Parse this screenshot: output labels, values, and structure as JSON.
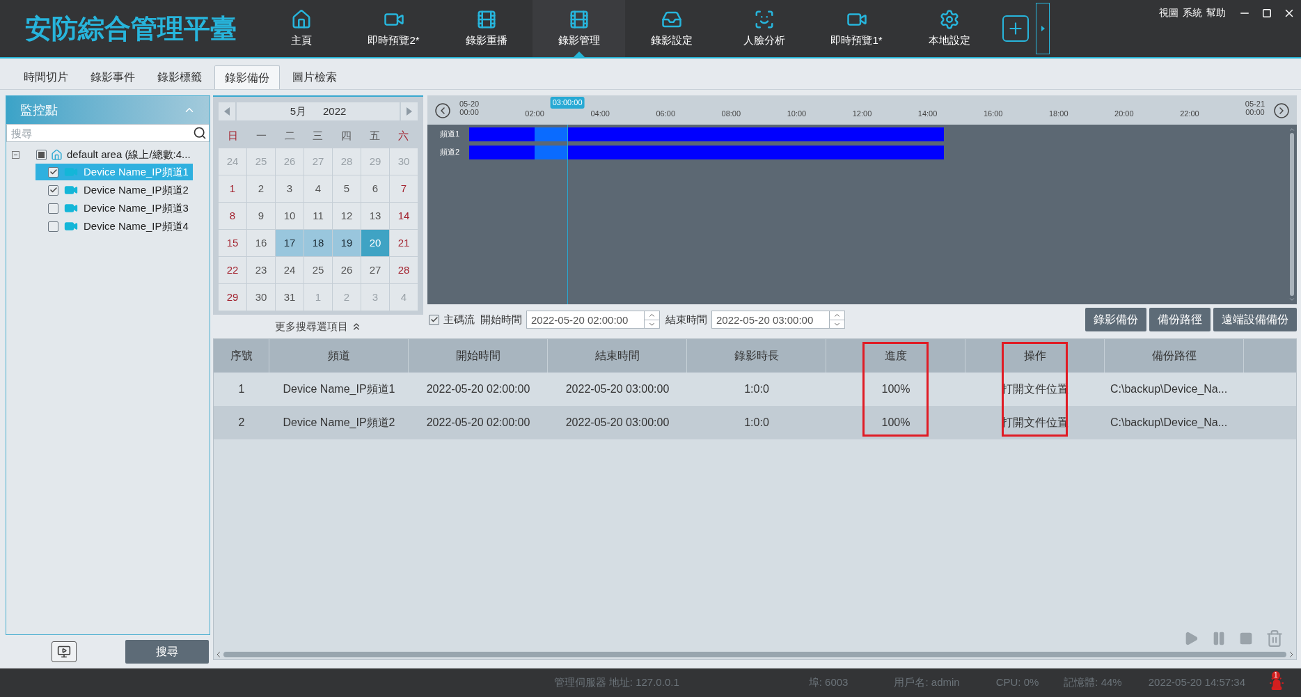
{
  "app": {
    "title": "安防綜合管理平臺"
  },
  "nav": [
    {
      "label": "主頁",
      "kind": "home",
      "selected": false
    },
    {
      "label": "即時預覽2*",
      "kind": "camera",
      "selected": false
    },
    {
      "label": "錄影重播",
      "kind": "reel",
      "selected": false
    },
    {
      "label": "錄影管理",
      "kind": "reel",
      "selected": true
    },
    {
      "label": "錄影設定",
      "kind": "tray",
      "selected": false
    },
    {
      "label": "人臉分析",
      "kind": "face",
      "selected": false
    },
    {
      "label": "即時預覽1*",
      "kind": "camera",
      "selected": false
    },
    {
      "label": "本地設定",
      "kind": "gear",
      "selected": false
    }
  ],
  "menu": [
    "視圖",
    "系統",
    "幫助"
  ],
  "tabs": [
    {
      "label": "時間切片",
      "selected": false
    },
    {
      "label": "錄影事件",
      "selected": false
    },
    {
      "label": "錄影標籤",
      "selected": false
    },
    {
      "label": "錄影備份",
      "selected": true
    },
    {
      "label": "圖片檢索",
      "selected": false
    }
  ],
  "sidebar": {
    "title": "監控點",
    "search": {
      "placeholder": "搜尋"
    },
    "tree": {
      "label": "default area (線上/總數:4...",
      "checked": true,
      "partial": true,
      "expanded": true,
      "children": [
        {
          "label": "Device Name_IP頻道1",
          "checked": true,
          "selected": true
        },
        {
          "label": "Device Name_IP頻道2",
          "checked": true,
          "selected": false
        },
        {
          "label": "Device Name_IP頻道3",
          "checked": false,
          "selected": false
        },
        {
          "label": "Device Name_IP頻道4",
          "checked": false,
          "selected": false
        }
      ]
    },
    "search_button": "搜尋"
  },
  "calendar": {
    "month": "5月",
    "year": "2022",
    "weekdays": [
      "日",
      "一",
      "二",
      "三",
      "四",
      "五",
      "六"
    ],
    "weeks": [
      [
        {
          "day": "24",
          "in_month": false,
          "has_record": false,
          "selected": false
        },
        {
          "day": "25",
          "in_month": false,
          "has_record": false,
          "selected": false
        },
        {
          "day": "26",
          "in_month": false,
          "has_record": false,
          "selected": false
        },
        {
          "day": "27",
          "in_month": false,
          "has_record": false,
          "selected": false
        },
        {
          "day": "28",
          "in_month": false,
          "has_record": false,
          "selected": false
        },
        {
          "day": "29",
          "in_month": false,
          "has_record": false,
          "selected": false
        },
        {
          "day": "30",
          "in_month": false,
          "has_record": false,
          "selected": false
        }
      ],
      [
        {
          "day": "1",
          "in_month": true,
          "has_record": false,
          "selected": false
        },
        {
          "day": "2",
          "in_month": true,
          "has_record": false,
          "selected": false
        },
        {
          "day": "3",
          "in_month": true,
          "has_record": false,
          "selected": false
        },
        {
          "day": "4",
          "in_month": true,
          "has_record": false,
          "selected": false
        },
        {
          "day": "5",
          "in_month": true,
          "has_record": false,
          "selected": false
        },
        {
          "day": "6",
          "in_month": true,
          "has_record": false,
          "selected": false
        },
        {
          "day": "7",
          "in_month": true,
          "has_record": false,
          "selected": false
        }
      ],
      [
        {
          "day": "8",
          "in_month": true,
          "has_record": false,
          "selected": false
        },
        {
          "day": "9",
          "in_month": true,
          "has_record": false,
          "selected": false
        },
        {
          "day": "10",
          "in_month": true,
          "has_record": false,
          "selected": false
        },
        {
          "day": "11",
          "in_month": true,
          "has_record": false,
          "selected": false
        },
        {
          "day": "12",
          "in_month": true,
          "has_record": false,
          "selected": false
        },
        {
          "day": "13",
          "in_month": true,
          "has_record": false,
          "selected": false
        },
        {
          "day": "14",
          "in_month": true,
          "has_record": false,
          "selected": false
        }
      ],
      [
        {
          "day": "15",
          "in_month": true,
          "has_record": false,
          "selected": false
        },
        {
          "day": "16",
          "in_month": true,
          "has_record": false,
          "selected": false
        },
        {
          "day": "17",
          "in_month": true,
          "has_record": true,
          "selected": false
        },
        {
          "day": "18",
          "in_month": true,
          "has_record": true,
          "selected": false
        },
        {
          "day": "19",
          "in_month": true,
          "has_record": true,
          "selected": false
        },
        {
          "day": "20",
          "in_month": true,
          "has_record": true,
          "selected": true
        },
        {
          "day": "21",
          "in_month": true,
          "has_record": false,
          "selected": false
        }
      ],
      [
        {
          "day": "22",
          "in_month": true,
          "has_record": false,
          "selected": false
        },
        {
          "day": "23",
          "in_month": true,
          "has_record": false,
          "selected": false
        },
        {
          "day": "24",
          "in_month": true,
          "has_record": false,
          "selected": false
        },
        {
          "day": "25",
          "in_month": true,
          "has_record": false,
          "selected": false
        },
        {
          "day": "26",
          "in_month": true,
          "has_record": false,
          "selected": false
        },
        {
          "day": "27",
          "in_month": true,
          "has_record": false,
          "selected": false
        },
        {
          "day": "28",
          "in_month": true,
          "has_record": false,
          "selected": false
        }
      ],
      [
        {
          "day": "29",
          "in_month": true,
          "has_record": false,
          "selected": false
        },
        {
          "day": "30",
          "in_month": true,
          "has_record": false,
          "selected": false
        },
        {
          "day": "31",
          "in_month": true,
          "has_record": false,
          "selected": false
        },
        {
          "day": "1",
          "in_month": false,
          "has_record": false,
          "selected": false
        },
        {
          "day": "2",
          "in_month": false,
          "has_record": false,
          "selected": false
        },
        {
          "day": "3",
          "in_month": false,
          "has_record": false,
          "selected": false
        },
        {
          "day": "4",
          "in_month": false,
          "has_record": false,
          "selected": false
        }
      ]
    ],
    "more_options": "更多搜尋選項目"
  },
  "timeline": {
    "start_date": "05-20",
    "start_time": "00:00",
    "end_date": "05-21",
    "end_time": "00:00",
    "ticks": [
      "02:00",
      "04:00",
      "06:00",
      "08:00",
      "10:00",
      "12:00",
      "14:00",
      "16:00",
      "18:00",
      "20:00",
      "22:00"
    ],
    "cursor": "03:00:00",
    "channels": [
      "頻道1",
      "頻道2"
    ]
  },
  "filters": {
    "main_stream": {
      "label": "主碼流",
      "checked": true
    },
    "start": {
      "label": "開始時間",
      "value": "2022-05-20 02:00:00"
    },
    "end": {
      "label": "結束時間",
      "value": "2022-05-20 03:00:00"
    }
  },
  "actions": [
    "錄影備份",
    "備份路徑",
    "遠端設備備份"
  ],
  "table": {
    "columns": [
      {
        "label": "序號",
        "highlighted": false
      },
      {
        "label": "頻道",
        "highlighted": false
      },
      {
        "label": "開始時間",
        "highlighted": false
      },
      {
        "label": "結束時間",
        "highlighted": false
      },
      {
        "label": "錄影時長",
        "highlighted": false
      },
      {
        "label": "進度",
        "highlighted": true
      },
      {
        "label": "操作",
        "highlighted": true
      },
      {
        "label": "備份路徑",
        "highlighted": false
      }
    ],
    "rows": [
      [
        "1",
        "Device Name_IP頻道1",
        "2022-05-20 02:00:00",
        "2022-05-20 03:00:00",
        "1:0:0",
        "100%",
        "打開文件位置",
        "C:\\backup\\Device_Na..."
      ],
      [
        "2",
        "Device Name_IP頻道2",
        "2022-05-20 02:00:00",
        "2022-05-20 03:00:00",
        "1:0:0",
        "100%",
        "打開文件位置",
        "C:\\backup\\Device_Na..."
      ]
    ]
  },
  "player_controls": {
    "disabled": true
  },
  "status_bar": {
    "items": [
      "管理伺服器 地址: 127.0.0.1",
      "埠: 6003",
      "用戶名: admin",
      "CPU: 0%",
      "記憶體: 44%",
      "2022-05-20 14:57:34"
    ],
    "alarm_count": "1"
  }
}
